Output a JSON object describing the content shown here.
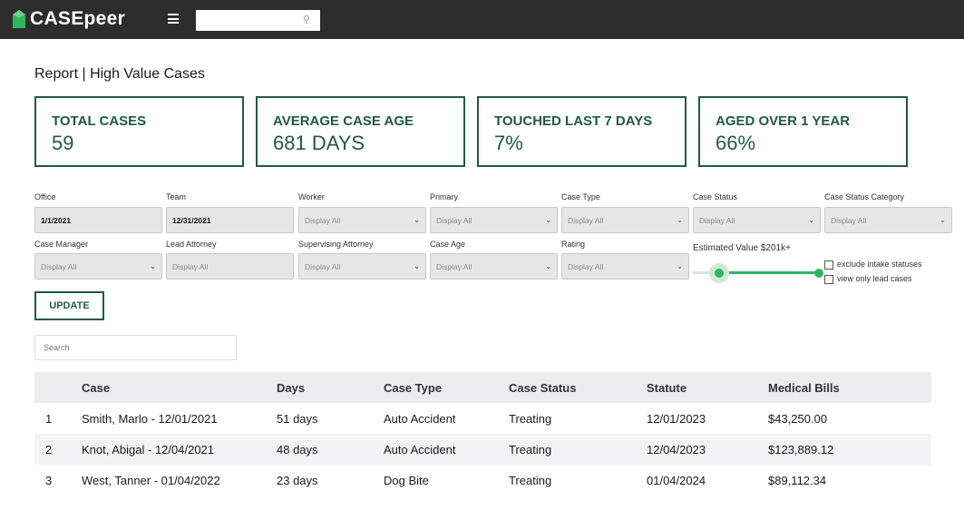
{
  "app": {
    "name": "CASEpeer",
    "brand_color": "#1f5a44",
    "accent_color": "#2fb560"
  },
  "header": {
    "search_value": ""
  },
  "page": {
    "title": "Report | High Value Cases"
  },
  "stats": [
    {
      "label": "TOTAL CASES",
      "value": "59"
    },
    {
      "label": "AVERAGE CASE AGE",
      "value": "681 DAYS"
    },
    {
      "label": "TOUCHED LAST 7 DAYS",
      "value": "7%"
    },
    {
      "label": "AGED OVER 1 YEAR",
      "value": "66%"
    }
  ],
  "filters": {
    "office": {
      "label": "Office",
      "value": "1/1/2021"
    },
    "team": {
      "label": "Team",
      "value": "12/31/2021"
    },
    "worker": {
      "label": "Worker",
      "value": "Display All"
    },
    "primary": {
      "label": "Primary",
      "value": "Display All"
    },
    "case_type": {
      "label": "Case Type",
      "value": "Display All"
    },
    "case_status": {
      "label": "Case Status",
      "value": "Display All"
    },
    "case_status_category": {
      "label": "Case Status Category",
      "value": "Display All"
    },
    "case_manager": {
      "label": "Case Manager",
      "value": "Display All"
    },
    "lead_attorney": {
      "label": "Lead Attorney",
      "value": "Display All"
    },
    "supervising_attorney": {
      "label": "Supervising Attorney",
      "value": "Display All"
    },
    "case_age": {
      "label": "Case Age",
      "value": "Display All"
    },
    "rating": {
      "label": "Rating",
      "value": "Display All"
    },
    "estimated_value": {
      "label": "Estimated Value $201k+"
    },
    "exclude_intake": {
      "label": "exclude intake statuses",
      "checked": false
    },
    "lead_cases_only": {
      "label": "view only lead cases",
      "checked": false
    }
  },
  "update_label": "UPDATE",
  "search": {
    "placeholder": "Search"
  },
  "table": {
    "columns": [
      "",
      "Case",
      "Days",
      "Case Type",
      "Case Status",
      "Statute",
      "Medical Bills"
    ],
    "rows": [
      [
        "1",
        "Smith, Marlo - 12/01/2021",
        "51 days",
        "Auto Accident",
        "Treating",
        "12/01/2023",
        "$43,250.00"
      ],
      [
        "2",
        "Knot, Abigal - 12/04/2021",
        "48 days",
        "Auto Accident",
        "Treating",
        "12/04/2023",
        "$123,889.12"
      ],
      [
        "3",
        "West, Tanner - 01/04/2022",
        "23 days",
        "Dog Bite",
        "Treating",
        "01/04/2024",
        "$89,112.34"
      ]
    ]
  }
}
